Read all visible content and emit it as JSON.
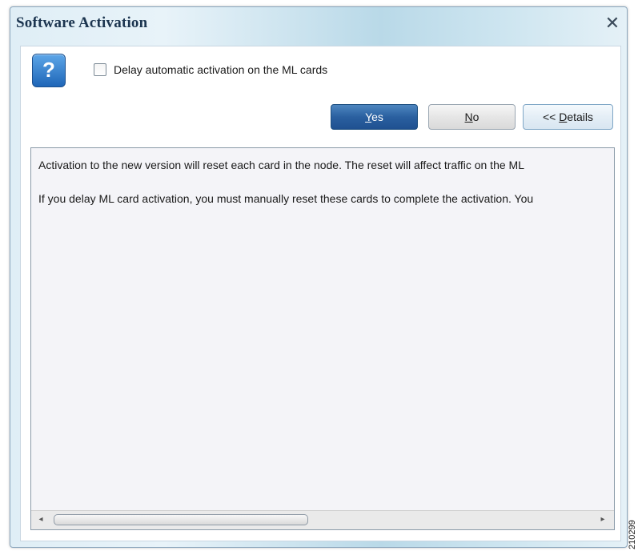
{
  "window": {
    "title": "Software Activation",
    "close_glyph": "✕",
    "close_icon": "close-icon"
  },
  "dialog": {
    "icon": "question-icon",
    "icon_glyph": "?",
    "checkbox_label": "Delay automatic activation on the ML cards",
    "checkbox_checked": false
  },
  "buttons": {
    "yes": "Yes",
    "no": "No",
    "details": "<< Details"
  },
  "details": {
    "lines": [
      "Activation to the new version will reset each card in the node. The reset will affect traffic on the ML",
      "If you delay ML card activation, you must manually reset these cards to complete the activation. You"
    ],
    "scroll_left_glyph": "◂",
    "scroll_right_glyph": "▸",
    "scroll_thumb_fraction": 0.44
  },
  "watermark": "210299",
  "colors": {
    "accent": "#2a60a0",
    "title_text": "#1c3550"
  }
}
